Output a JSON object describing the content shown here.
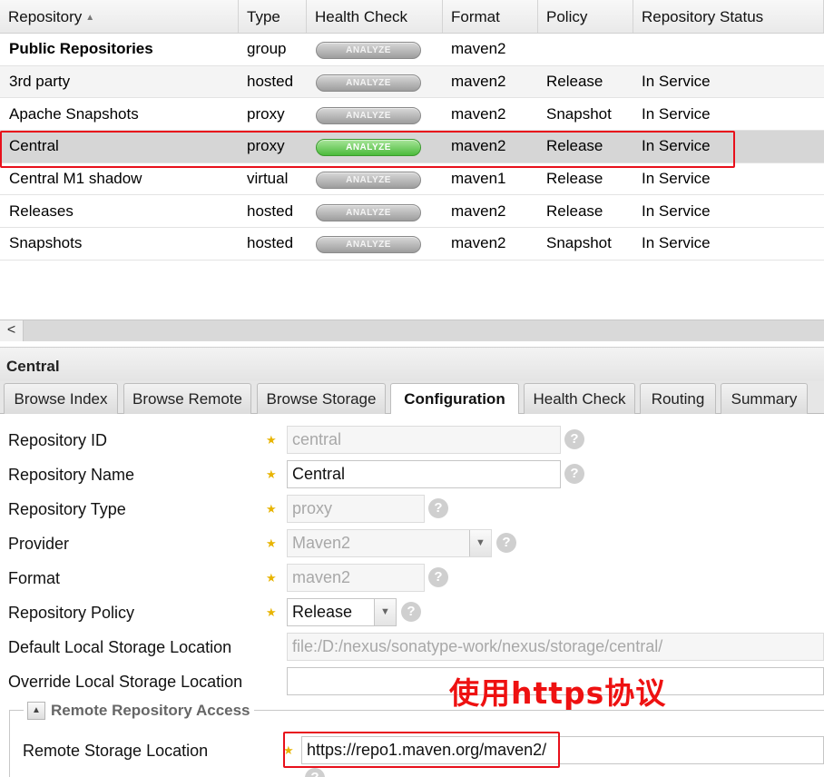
{
  "grid": {
    "columns": [
      "Repository",
      "Type",
      "Health Check",
      "Format",
      "Policy",
      "Repository Status"
    ],
    "sort_indicator": "▲",
    "rows": [
      {
        "repository": "Public Repositories",
        "type": "group",
        "health": "ANALYZE",
        "format": "maven2",
        "policy": "",
        "status": ""
      },
      {
        "repository": "3rd party",
        "type": "hosted",
        "health": "ANALYZE",
        "format": "maven2",
        "policy": "Release",
        "status": "In Service"
      },
      {
        "repository": "Apache Snapshots",
        "type": "proxy",
        "health": "ANALYZE",
        "format": "maven2",
        "policy": "Snapshot",
        "status": "In Service"
      },
      {
        "repository": "Central",
        "type": "proxy",
        "health": "ANALYZE",
        "format": "maven2",
        "policy": "Release",
        "status": "In Service"
      },
      {
        "repository": "Central M1 shadow",
        "type": "virtual",
        "health": "ANALYZE",
        "format": "maven1",
        "policy": "Release",
        "status": "In Service"
      },
      {
        "repository": "Releases",
        "type": "hosted",
        "health": "ANALYZE",
        "format": "maven2",
        "policy": "Release",
        "status": "In Service"
      },
      {
        "repository": "Snapshots",
        "type": "hosted",
        "health": "ANALYZE",
        "format": "maven2",
        "policy": "Snapshot",
        "status": "In Service"
      }
    ],
    "selected_row": "Central",
    "selected_highlight_color": "#e8101b"
  },
  "scroll": {
    "left_arrow": "<"
  },
  "panel": {
    "title": "Central",
    "tabs": [
      "Browse Index",
      "Browse Remote",
      "Browse Storage",
      "Configuration",
      "Health Check",
      "Routing",
      "Summary"
    ],
    "active_tab": "Configuration"
  },
  "form": {
    "repository_id": {
      "label": "Repository ID",
      "value": "central"
    },
    "repository_name": {
      "label": "Repository Name",
      "value": "Central"
    },
    "repository_type": {
      "label": "Repository Type",
      "value": "proxy"
    },
    "provider": {
      "label": "Provider",
      "value": "Maven2"
    },
    "format": {
      "label": "Format",
      "value": "maven2"
    },
    "repository_policy": {
      "label": "Repository Policy",
      "value": "Release"
    },
    "default_storage": {
      "label": "Default Local Storage Location",
      "value": "file:/D:/nexus/sonatype-work/nexus/storage/central/"
    },
    "override_storage": {
      "label": "Override Local Storage Location",
      "value": ""
    },
    "remote_section": {
      "legend": "Remote Repository Access"
    },
    "remote_location": {
      "label": "Remote Storage Location",
      "value": "https://repo1.maven.org/maven2/"
    }
  },
  "annotation": {
    "text": "使用https协议",
    "color": "#ee1111"
  },
  "icons": {
    "required": "star-icon",
    "help": "help-icon",
    "dropdown": "chevron-down-icon",
    "collapse": "chevron-up-icon"
  }
}
